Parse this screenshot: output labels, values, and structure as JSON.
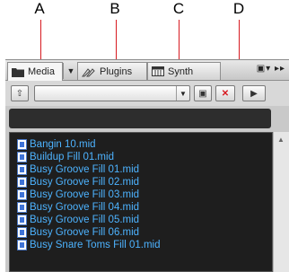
{
  "callouts": [
    {
      "letter": "A"
    },
    {
      "letter": "B"
    },
    {
      "letter": "C"
    },
    {
      "letter": "D"
    }
  ],
  "tabs": [
    {
      "label": "Media",
      "icon": "folder-icon"
    },
    {
      "label": "Plugins",
      "icon": "plugins-icon"
    },
    {
      "label": "Synth",
      "icon": "synth-icon"
    }
  ],
  "tabbar_menu_glyph": "▣▾ ▸▸",
  "toolbar": {
    "up_glyph": "⇧",
    "combo_value": "",
    "combo_arrow": "▼",
    "save_glyph": "▣",
    "delete_glyph": "✕",
    "play_glyph": "▶"
  },
  "files": [
    "Bangin 10.mid",
    "Buildup Fill 01.mid",
    "Busy Groove Fill 01.mid",
    "Busy Groove Fill 02.mid",
    "Busy Groove Fill 03.mid",
    "Busy Groove Fill 04.mid",
    "Busy Groove Fill 05.mid",
    "Busy Groove Fill 06.mid",
    "Busy Snare Toms Fill 01.mid"
  ],
  "colors": {
    "accent_red": "#d71920",
    "file_text": "#4db3ff",
    "list_bg": "#1e1e1e"
  }
}
